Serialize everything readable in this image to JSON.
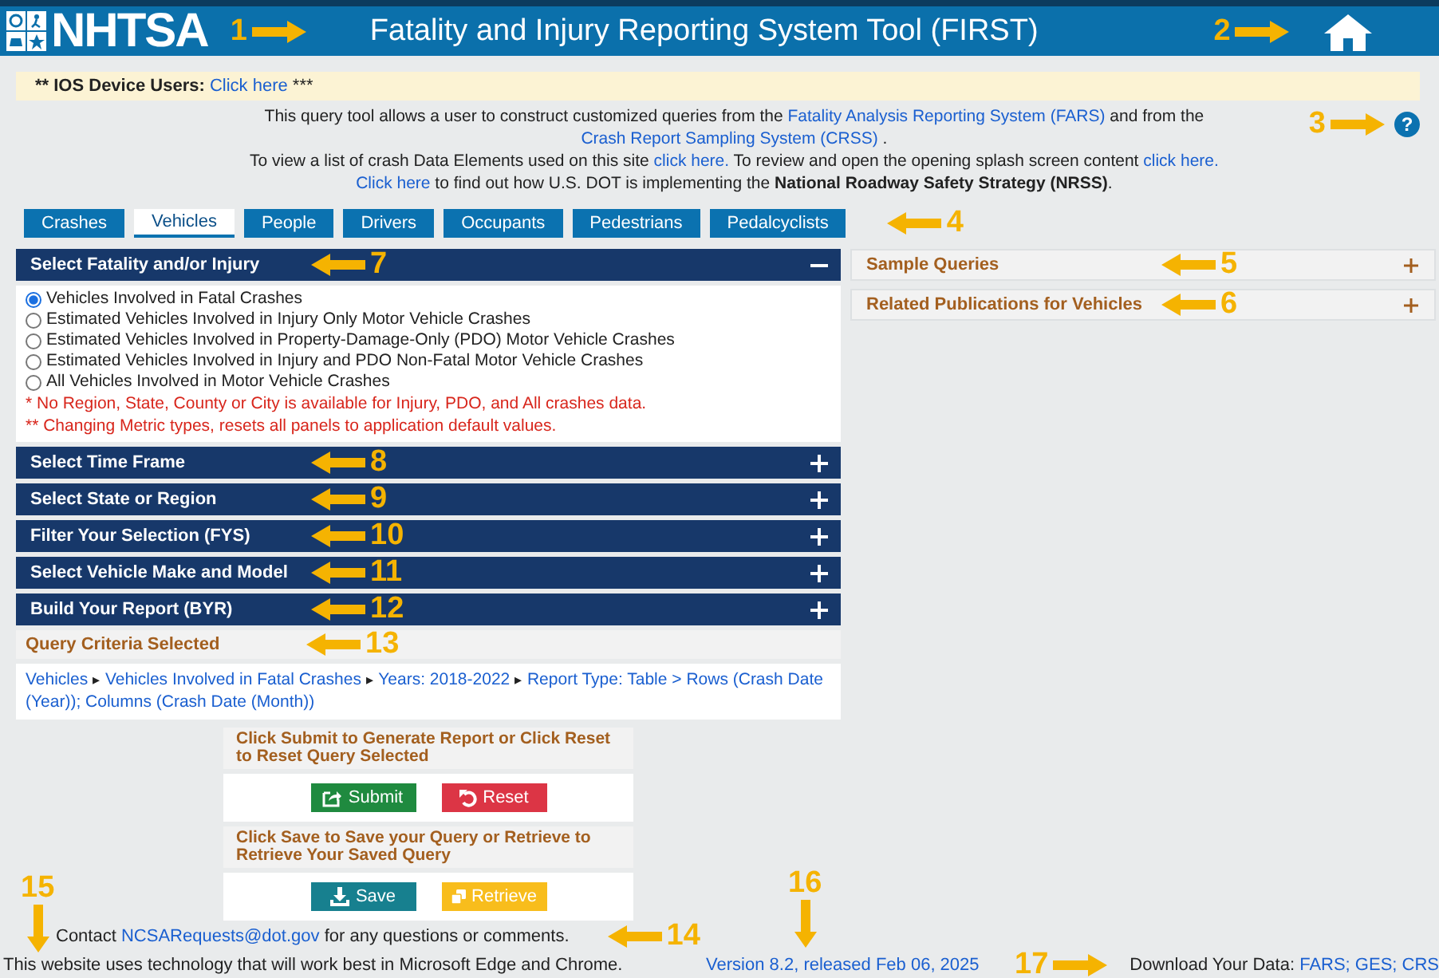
{
  "header": {
    "logo": "NHTSA",
    "title": "Fatality and Injury Reporting System Tool (FIRST)",
    "callouts": [
      {
        "number": "1",
        "kind": "right"
      },
      {
        "number": "2",
        "kind": "right"
      }
    ]
  },
  "notice": {
    "label": "** IOS Device Users:",
    "link": "Click here",
    "suffix": "***"
  },
  "intro": [
    [
      {
        "text": "This query tool allows a user to construct customized queries from the ",
        "kind": "text"
      },
      {
        "text": "Fatality Analysis Reporting System (FARS)",
        "kind": "link"
      },
      {
        "text": " and from the ",
        "kind": "text"
      },
      {
        "text": "Crash Report Sampling System (CRSS)",
        "kind": "link"
      },
      {
        "text": " .",
        "kind": "text"
      }
    ],
    [
      {
        "text": "To view a list of crash Data Elements used on this site ",
        "kind": "text"
      },
      {
        "text": "click here.",
        "kind": "link"
      },
      {
        "text": " To review and open the opening splash screen content ",
        "kind": "text"
      },
      {
        "text": "click here.",
        "kind": "link"
      }
    ],
    [
      {
        "text": "Click here",
        "kind": "link"
      },
      {
        "text": " to find out how U.S. DOT is implementing the ",
        "kind": "text"
      },
      {
        "text": "National Roadway Safety Strategy (NRSS)",
        "kind": "bold"
      },
      {
        "text": ".",
        "kind": "text"
      }
    ]
  ],
  "help": {
    "symbol": "?",
    "callout": {
      "number": "3",
      "kind": "right"
    }
  },
  "tabs": [
    {
      "label": "Crashes",
      "selected": false
    },
    {
      "label": "Vehicles",
      "selected": true
    },
    {
      "label": "People",
      "selected": false
    },
    {
      "label": "Drivers",
      "selected": false
    },
    {
      "label": "Occupants",
      "selected": false
    },
    {
      "label": "Pedestrians",
      "selected": false
    },
    {
      "label": "Pedalcyclists",
      "selected": false
    }
  ],
  "tabs_callout": {
    "number": "4",
    "kind": "left"
  },
  "panels": [
    {
      "title": "Select Fatality and/or Injury",
      "expanded": true,
      "callout": {
        "number": "7",
        "kind": "left"
      },
      "options": [
        {
          "label": "Vehicles Involved in Fatal Crashes",
          "selected": true
        },
        {
          "label": "Estimated Vehicles Involved in Injury Only Motor Vehicle Crashes",
          "selected": false
        },
        {
          "label": "Estimated Vehicles Involved in Property-Damage-Only (PDO) Motor Vehicle Crashes",
          "selected": false
        },
        {
          "label": "Estimated Vehicles Involved in Injury and PDO Non-Fatal Motor Vehicle Crashes",
          "selected": false
        },
        {
          "label": "All Vehicles Involved in Motor Vehicle Crashes",
          "selected": false
        }
      ],
      "notes": [
        "* No Region, State, County or City is available for Injury, PDO, and All crashes data.",
        "** Changing Metric types, resets all panels to application default values."
      ]
    },
    {
      "title": "Select Time Frame",
      "expanded": false,
      "callout": {
        "number": "8",
        "kind": "left"
      }
    },
    {
      "title": "Select State or Region",
      "expanded": false,
      "callout": {
        "number": "9",
        "kind": "left"
      }
    },
    {
      "title": "Filter Your Selection (FYS)",
      "expanded": false,
      "callout": {
        "number": "10",
        "kind": "left"
      }
    },
    {
      "title": "Select Vehicle Make and Model",
      "expanded": false,
      "callout": {
        "number": "11",
        "kind": "left"
      }
    },
    {
      "title": "Build Your Report (BYR)",
      "expanded": false,
      "callout": {
        "number": "12",
        "kind": "left"
      }
    }
  ],
  "query_criteria": {
    "title": "Query Criteria Selected",
    "callout": {
      "number": "13",
      "kind": "left"
    },
    "separator": "▸",
    "items": [
      "Vehicles",
      "Vehicles Involved in Fatal Crashes",
      "Years: 2018-2022",
      "Report Type: Table > Rows (Crash Date (Year)); Columns (Crash Date (Month))"
    ]
  },
  "actions": [
    {
      "heading": "Click Submit to Generate Report or Click Reset to Reset Query Selected",
      "buttons": [
        {
          "label": "Submit",
          "kind": "submit"
        },
        {
          "label": "Reset",
          "kind": "reset"
        }
      ]
    },
    {
      "heading": "Click Save to Save your Query or Retrieve to Retrieve Your Saved Query",
      "buttons": [
        {
          "label": "Save",
          "kind": "save"
        },
        {
          "label": "Retrieve",
          "kind": "retrieve"
        }
      ]
    }
  ],
  "side_panels": [
    {
      "title": "Sample Queries",
      "callout": {
        "number": "5",
        "kind": "left"
      }
    },
    {
      "title": "Related Publications for Vehicles",
      "callout": {
        "number": "6",
        "kind": "left"
      }
    }
  ],
  "footer": {
    "contact": [
      {
        "text": "Contact ",
        "kind": "text"
      },
      {
        "text": "NCSARequests@dot.gov",
        "kind": "link"
      },
      {
        "text": " for any questions or comments.",
        "kind": "text"
      }
    ],
    "contact_callout": {
      "number": "14",
      "kind": "left"
    },
    "browser_note": "This website uses technology that will work best in Microsoft Edge and Chrome.",
    "browser_callout": {
      "number": "15",
      "kind": "down"
    },
    "version": "Version 8.2, released Feb 06, 2025",
    "version_callout": {
      "number": "16",
      "kind": "down"
    },
    "download_label": "Download Your Data:",
    "download_links": "FARS; GES; CRS",
    "download_callout": {
      "number": "17",
      "kind": "right"
    }
  }
}
